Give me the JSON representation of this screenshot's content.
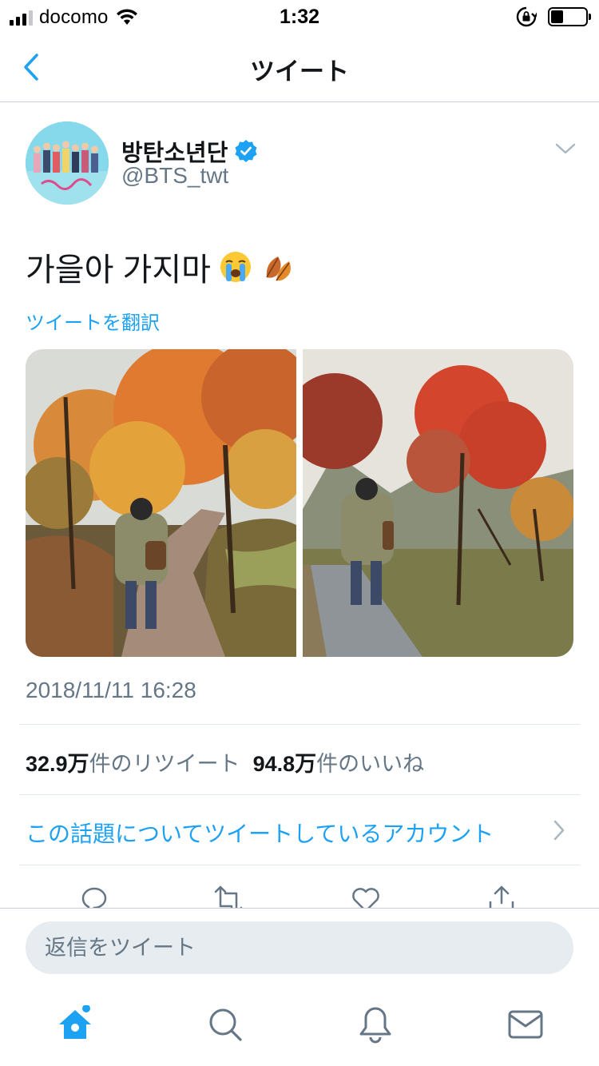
{
  "status_bar": {
    "carrier": "docomo",
    "time": "1:32",
    "battery_level": 0.35
  },
  "nav": {
    "title": "ツイート",
    "back_icon": "chevron-left-icon"
  },
  "tweet": {
    "display_name": "방탄소년단",
    "handle": "@BTS_twt",
    "verified": true,
    "text": "가을아 가지마",
    "emojis": [
      "loudly-crying-face",
      "fallen-leaf"
    ],
    "translate_label": "ツイートを翻訳",
    "photos": [
      {
        "name": "autumn-path-photo-1"
      },
      {
        "name": "autumn-path-photo-2"
      }
    ],
    "timestamp": "2018/11/11 16:28",
    "retweets_count": "32.9万",
    "retweets_label": "件のリツイート",
    "likes_count": "94.8万",
    "likes_label": "件のいいね",
    "topic_link": "この話題についてツイートしているアカウント"
  },
  "actions": [
    "reply-icon",
    "retweet-icon",
    "like-icon",
    "share-icon"
  ],
  "reply_bar": {
    "placeholder": "返信をツイート"
  },
  "tab_bar": {
    "items": [
      "home-icon",
      "search-icon",
      "notifications-icon",
      "messages-icon"
    ],
    "accent": "#1da1f2"
  },
  "colors": {
    "accent": "#1da1f2",
    "text_primary": "#14171a",
    "text_secondary": "#657786"
  }
}
